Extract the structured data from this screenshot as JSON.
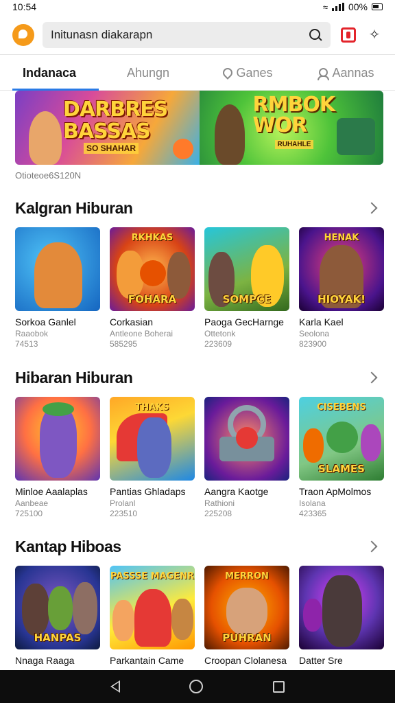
{
  "status_bar": {
    "time": "10:54",
    "battery": "00%"
  },
  "search": {
    "text": "Initunasn diakarapn"
  },
  "tabs": [
    {
      "label": "Indanaca",
      "icon": ""
    },
    {
      "label": "Ahungn",
      "icon": ""
    },
    {
      "label": "Ganes",
      "icon": "pin-icon"
    },
    {
      "label": "Aannas",
      "icon": "person-icon"
    }
  ],
  "banner": {
    "left_title": "DARBRES BASSAS",
    "left_sub": "SO SHAHAR",
    "right_title": "RMBOK WOR",
    "right_sub": "RUHAHLE",
    "caption": "Otioteoe6S120N"
  },
  "sections": [
    {
      "title": "Kalgran Hiburan",
      "cards": [
        {
          "name": "Sorkoa Ganlel",
          "sub": "Raaobok",
          "num": "74513",
          "thumb_top": "",
          "thumb_label": ""
        },
        {
          "name": "Corkasian",
          "sub": "Antleone Boherai",
          "num": "585295",
          "thumb_top": "RKHKAS",
          "thumb_label": "FOHARA"
        },
        {
          "name": "Paoga GecHarnge",
          "sub": "Ottetonk",
          "num": "223609",
          "thumb_top": "",
          "thumb_label": "SOMPCE"
        },
        {
          "name": "Karla Kael",
          "sub": "Seolona",
          "num": "823900",
          "thumb_top": "HENAK",
          "thumb_label": "HIOYAK!"
        }
      ]
    },
    {
      "title": "Hibaran Hiburan",
      "cards": [
        {
          "name": "Minloe Aaalaplas",
          "sub": "Aanbeae",
          "num": "725100",
          "thumb_top": "",
          "thumb_label": ""
        },
        {
          "name": "Pantias Ghladaps",
          "sub": "Prolanl",
          "num": "223510",
          "thumb_top": "THAKS",
          "thumb_label": ""
        },
        {
          "name": "Aangra Kaotge",
          "sub": "Rathioni",
          "num": "225208",
          "thumb_top": "",
          "thumb_label": ""
        },
        {
          "name": "Traon ApMolmos",
          "sub": "Isolana",
          "num": "423365",
          "thumb_top": "CISEBENS",
          "thumb_label": "SLAMES"
        }
      ]
    },
    {
      "title": "Kantap Hiboas",
      "cards": [
        {
          "name": "Nnaga Raaga",
          "sub": "",
          "num": "",
          "thumb_top": "",
          "thumb_label": "HANPAS"
        },
        {
          "name": "Parkantain Came",
          "sub": "",
          "num": "",
          "thumb_top": "PASSSE MAGENR",
          "thumb_label": ""
        },
        {
          "name": "Croopan Clolanesa",
          "sub": "",
          "num": "",
          "thumb_top": "MERRON",
          "thumb_label": "PUHRAN"
        },
        {
          "name": "Datter Sre",
          "sub": "",
          "num": "",
          "thumb_top": "",
          "thumb_label": ""
        }
      ]
    }
  ],
  "colors": {
    "accent": "#2a7be6",
    "logo": "#f59a1a",
    "red_app": "#e3242b"
  }
}
